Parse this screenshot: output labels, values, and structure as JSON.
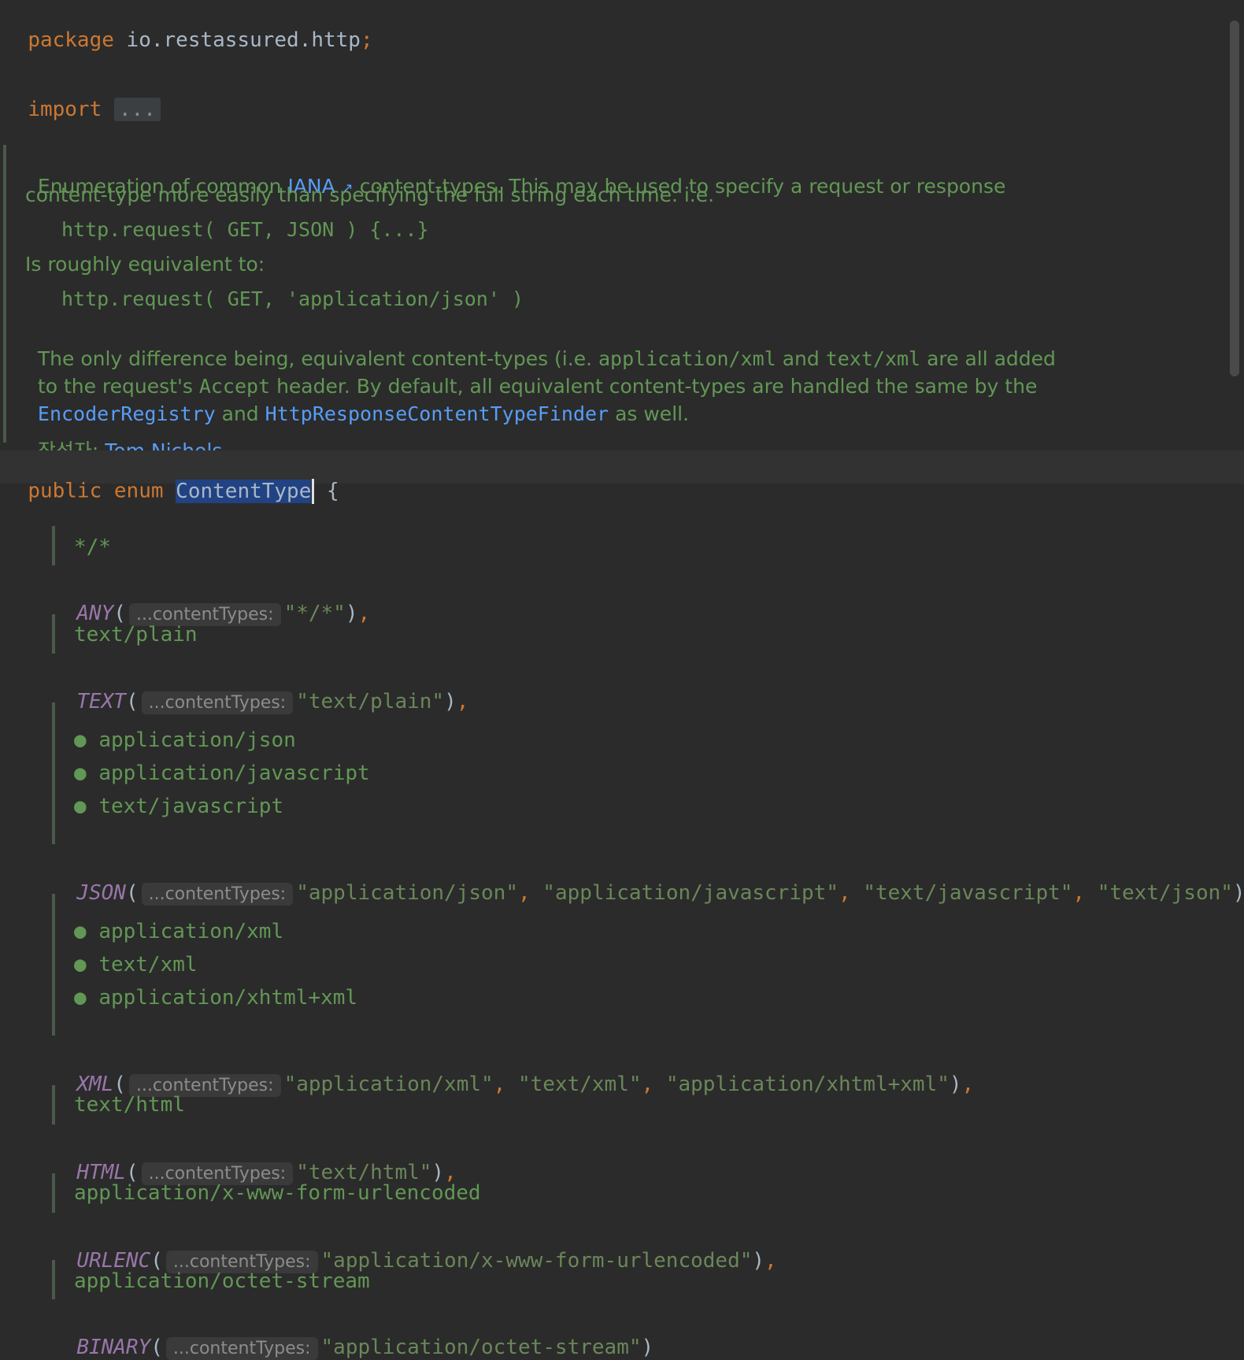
{
  "package_line": {
    "kw": "package",
    "name": "io.restassured.http",
    "semi": ";"
  },
  "import_line": {
    "kw": "import",
    "folded": "..."
  },
  "javadoc": {
    "p1_a": "Enumeration of common ",
    "p1_link": "IANA",
    "p1_link_icon": "↗",
    "p1_b": " content-types. This may be used to specify a request or response",
    "p2": "content-type more easily than specifying the full string each time. i.e.",
    "code1": "http.request( GET, JSON ) {...}",
    "p3": "Is roughly equivalent to:",
    "code2": "http.request( GET, 'application/json' )",
    "p4_a": "The only difference being, equivalent content-types (i.e. ",
    "p4_code1": "application/xml",
    "p4_b": " and ",
    "p4_code2": "text/xml",
    "p4_c": " are all added",
    "p5_a": "to the request's ",
    "p5_code": "Accept",
    "p5_b": " header. By default, all equivalent content-types are handled the same by the",
    "p6_link1": "EncoderRegistry",
    "p6_a": " and ",
    "p6_link2": "HttpResponseContentTypeFinder",
    "p6_b": " as well.",
    "author_label": "작성자:",
    "author_name": "Tom Nichols"
  },
  "decl_line": {
    "kw1": "public",
    "kw2": "enum",
    "name": "ContentType",
    "brace": "{"
  },
  "hint_label": "...contentTypes:",
  "entries": {
    "any_doc": "*/*",
    "any_name": "ANY",
    "any_args": "\"*/*\"",
    "text_doc": "text/plain",
    "text_name": "TEXT",
    "text_args": "\"text/plain\"",
    "json_bullets": [
      "application/json",
      "application/javascript",
      "text/javascript"
    ],
    "json_name": "JSON",
    "json_arg1": "\"application/json\"",
    "json_arg2": "\"application/javascript\"",
    "json_arg3": "\"text/javascript\"",
    "json_arg4": "\"text/json\"",
    "xml_bullets": [
      "application/xml",
      "text/xml",
      "application/xhtml+xml"
    ],
    "xml_name": "XML",
    "xml_arg1": "\"application/xml\"",
    "xml_arg2": "\"text/xml\"",
    "xml_arg3": "\"application/xhtml+xml\"",
    "html_doc": "text/html",
    "html_name": "HTML",
    "html_args": "\"text/html\"",
    "urlenc_doc": "application/x-www-form-urlencoded",
    "urlenc_name": "URLENC",
    "urlenc_args": "\"application/x-www-form-urlencoded\"",
    "binary_doc": "application/octet-stream",
    "binary_name": "BINARY",
    "binary_args": "\"application/octet-stream\""
  }
}
